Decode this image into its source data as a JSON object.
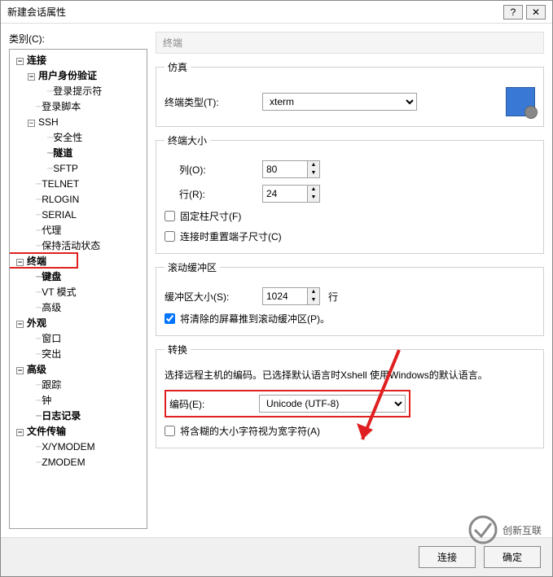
{
  "title": "新建会话属性",
  "category_label": "类别(C):",
  "tree": {
    "connection": "连接",
    "userAuth": "用户身份验证",
    "loginPrompt": "登录提示符",
    "loginScript": "登录脚本",
    "ssh": "SSH",
    "security": "安全性",
    "tunnel": "隧道",
    "sftp": "SFTP",
    "telnet": "TELNET",
    "rlogin": "RLOGIN",
    "serial": "SERIAL",
    "proxy": "代理",
    "keepalive": "保持活动状态",
    "terminal": "终端",
    "keyboard": "键盘",
    "vtmode": "VT 模式",
    "advanced": "高级",
    "appearance": "外观",
    "window": "窗口",
    "highlight": "突出",
    "advanced2": "高级",
    "trace": "跟踪",
    "bell": "钟",
    "logging": "日志记录",
    "filetransfer": "文件传输",
    "xymodem": "X/YMODEM",
    "zmodem": "ZMODEM"
  },
  "panel_header": "终端",
  "emulation": {
    "legend": "仿真",
    "termtype_label": "终端类型(T):",
    "termtype_value": "xterm"
  },
  "termsize": {
    "legend": "终端大小",
    "cols_label": "列(O):",
    "cols_value": "80",
    "rows_label": "行(R):",
    "rows_value": "24",
    "fixedcols_label": "固定柱尺寸(F)",
    "reset_label": "连接时重置端子尺寸(C)"
  },
  "scrollback": {
    "legend": "滚动缓冲区",
    "size_label": "缓冲区大小(S):",
    "size_value": "1024",
    "unit": "行",
    "pushclear_label": "将清除的屏幕推到滚动缓冲区(P)。"
  },
  "conversion": {
    "legend": "转换",
    "desc": "选择远程主机的编码。已选择默认语言时Xshell 使用Windows的默认语言。",
    "encoding_label": "编码(E):",
    "encoding_value": "Unicode (UTF-8)",
    "ambiguous_label": "将含糊的大小字符视为宽字符(A)"
  },
  "footer": {
    "connect": "连接",
    "ok": "确定"
  },
  "logo_text": "创新互联"
}
